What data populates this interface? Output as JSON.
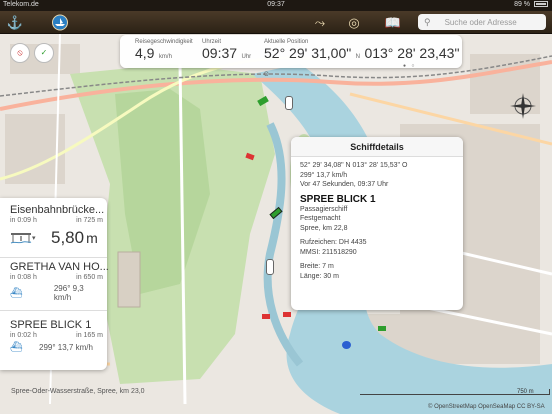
{
  "status": {
    "carrier": "Telekom.de",
    "time": "09:37",
    "battery": "89 %"
  },
  "toolbar": {
    "search_placeholder": "Suche oder Adresse"
  },
  "info": {
    "speed_label": "Reisegeschwindigkeit",
    "speed_value": "4,9",
    "speed_unit": "km/h",
    "time_label": "Uhrzeit",
    "time_value": "09:37",
    "time_unit": "Uhr",
    "pos_label": "Aktuelle Position",
    "pos_lat": "52° 29' 31,00\"",
    "pos_lat_dir": "N",
    "pos_lon": "013° 28' 23,43\"",
    "pos_lon_dir": "O"
  },
  "list": [
    {
      "title": "Eisenbahnbrücke...",
      "ago": "in 0:09 h",
      "dist": "in 725 m",
      "value": "5,80",
      "value_unit": "m"
    },
    {
      "title": "GRETHA VAN HO...",
      "ago": "in 0:08 h",
      "dist": "in 650 m",
      "course": "296° 9,3 km/h"
    },
    {
      "title": "SPREE BLICK 1",
      "ago": "in 0:02 h",
      "dist": "in 165 m",
      "course": "299° 13,7 km/h"
    }
  ],
  "popup": {
    "title": "Schiffdetails",
    "coords": "52° 29' 34,08\" N  013° 28' 15,53\" O",
    "course": "299° 13,7 km/h",
    "ago": "Vor 47 Sekunden, 09:37 Uhr",
    "name": "SPREE BLICK 1",
    "type": "Passagierschiff",
    "status": "Festgemacht",
    "location": "Spree, km 22,8",
    "callsign": "Rufzeichen: DH 4435",
    "mmsi": "MMSI: 211518290",
    "width": "Breite: 7 m",
    "length": "Länge: 30 m"
  },
  "map": {
    "road_label": "Spree-Oder-Wasserstraße, Spree, km 23,0",
    "scale": "750 m",
    "attribution": "© OpenStreetMap OpenSeaMap CC BY-SA"
  }
}
